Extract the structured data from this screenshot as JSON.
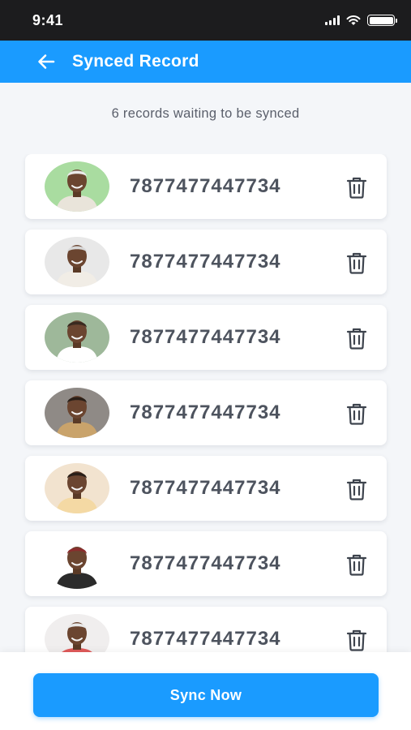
{
  "status_bar": {
    "time": "9:41"
  },
  "header": {
    "title": "Synced Record",
    "back_icon": "arrow-left-icon"
  },
  "subtitle": "6 records waiting to be synced",
  "records": [
    {
      "id": "7877477447734",
      "avatar_bg": "#a9dca0"
    },
    {
      "id": "7877477447734",
      "avatar_bg": "#e8e8e8"
    },
    {
      "id": "7877477447734",
      "avatar_bg": "#9eb89a"
    },
    {
      "id": "7877477447734",
      "avatar_bg": "#8f8a86"
    },
    {
      "id": "7877477447734",
      "avatar_bg": "#f2e3cf"
    },
    {
      "id": "7877477447734",
      "avatar_bg": "#ffffff"
    },
    {
      "id": "7877477447734",
      "avatar_bg": "#f0eeee"
    }
  ],
  "actions": {
    "sync_label": "Sync Now"
  },
  "colors": {
    "primary": "#1a9bff",
    "text": "#4d535e"
  }
}
